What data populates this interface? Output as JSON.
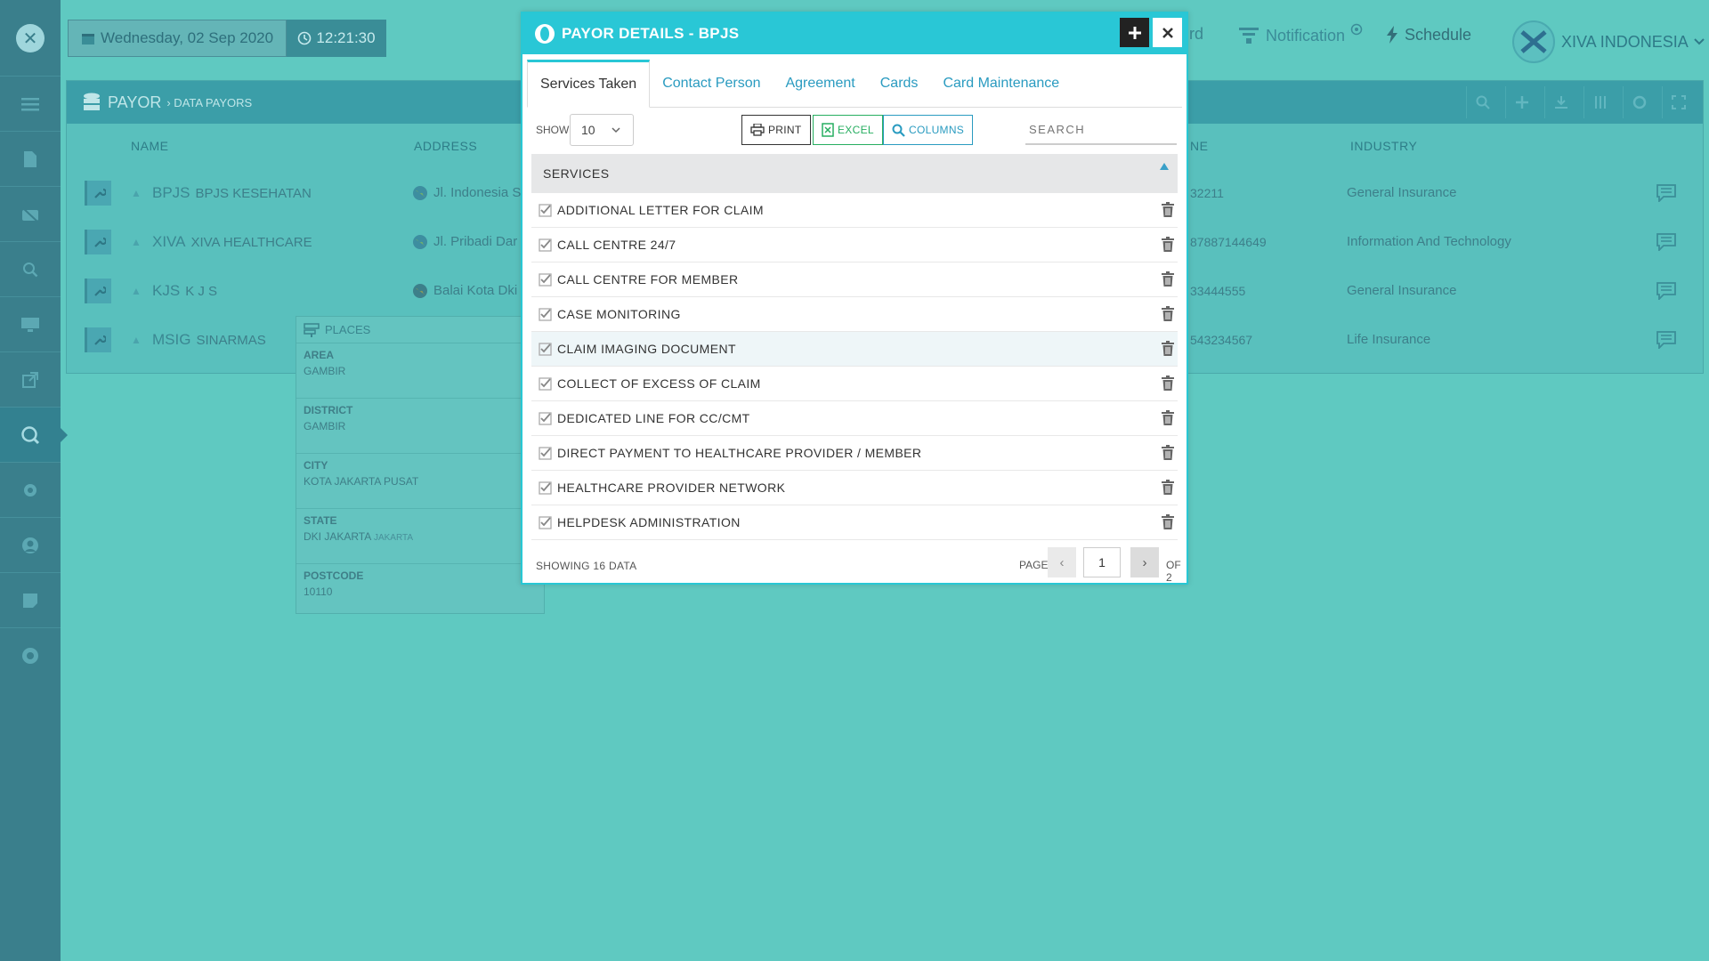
{
  "topbar": {
    "date": "Wednesday, 02 Sep 2020",
    "time": "12:21:30",
    "dashboard_fragment": "rd",
    "notification": "Notification",
    "schedule": "Schedule",
    "company": "XIVA INDONESIA"
  },
  "panel": {
    "title": "PAYOR",
    "breadcrumb": "› DATA PAYORS",
    "columns": {
      "name": "NAME",
      "address": "ADDRESS",
      "phone": "NE",
      "industry": "INDUSTRY"
    },
    "rows": [
      {
        "code": "BPJS",
        "name": "BPJS KESEHATAN",
        "address": "Jl. Indonesia S",
        "phone": "32211",
        "industry": "General Insurance"
      },
      {
        "code": "XIVA",
        "name": "XIVA HEALTHCARE",
        "address": "Jl. Pribadi Dar",
        "phone": "87887144649",
        "industry": "Information And Technology"
      },
      {
        "code": "KJS",
        "name": "K J S",
        "address": "Balai Kota Dki",
        "phone": "33444555",
        "industry": "General Insurance"
      },
      {
        "code": "MSIG",
        "name": "SINARMAS",
        "address": "",
        "phone": "543234567",
        "industry": "Life Insurance"
      }
    ]
  },
  "places": {
    "title": "PLACES",
    "fields": [
      {
        "label": "AREA",
        "value": "GAMBIR",
        "extra": ""
      },
      {
        "label": "DISTRICT",
        "value": "GAMBIR",
        "extra": ""
      },
      {
        "label": "CITY",
        "value": "KOTA JAKARTA PUSAT",
        "extra": ""
      },
      {
        "label": "STATE",
        "value": "DKI JAKARTA",
        "extra": "JAKARTA"
      },
      {
        "label": "POSTCODE",
        "value": "10110",
        "extra": ""
      }
    ]
  },
  "modal": {
    "title": "PAYOR DETAILS - BPJS",
    "tabs": [
      "Services Taken",
      "Contact Person",
      "Agreement",
      "Cards",
      "Card Maintenance"
    ],
    "show_label": "SHOW",
    "show_value": "10",
    "print_label": "PRINT",
    "excel_label": "EXCEL",
    "columns_label": "COLUMNS",
    "search_placeholder": "SEARCH",
    "column_header": "SERVICES",
    "services": [
      "ADDITIONAL LETTER FOR CLAIM",
      "CALL CENTRE 24/7",
      "CALL CENTRE FOR MEMBER",
      "CASE MONITORING",
      "CLAIM IMAGING DOCUMENT",
      "COLLECT OF EXCESS OF CLAIM",
      "DEDICATED LINE FOR CC/CMT",
      "DIRECT PAYMENT TO HEALTHCARE PROVIDER / MEMBER",
      "HEALTHCARE PROVIDER NETWORK",
      "HELPDESK ADMINISTRATION"
    ],
    "showing": "SHOWING 16 DATA",
    "page_label": "PAGE",
    "page": "1",
    "of_label": "OF 2"
  },
  "colors": {
    "accent": "#29c7d6",
    "link": "#2a9bc0",
    "sidebar": "#3a7f8c",
    "backdrop": "#5fc9c1"
  }
}
